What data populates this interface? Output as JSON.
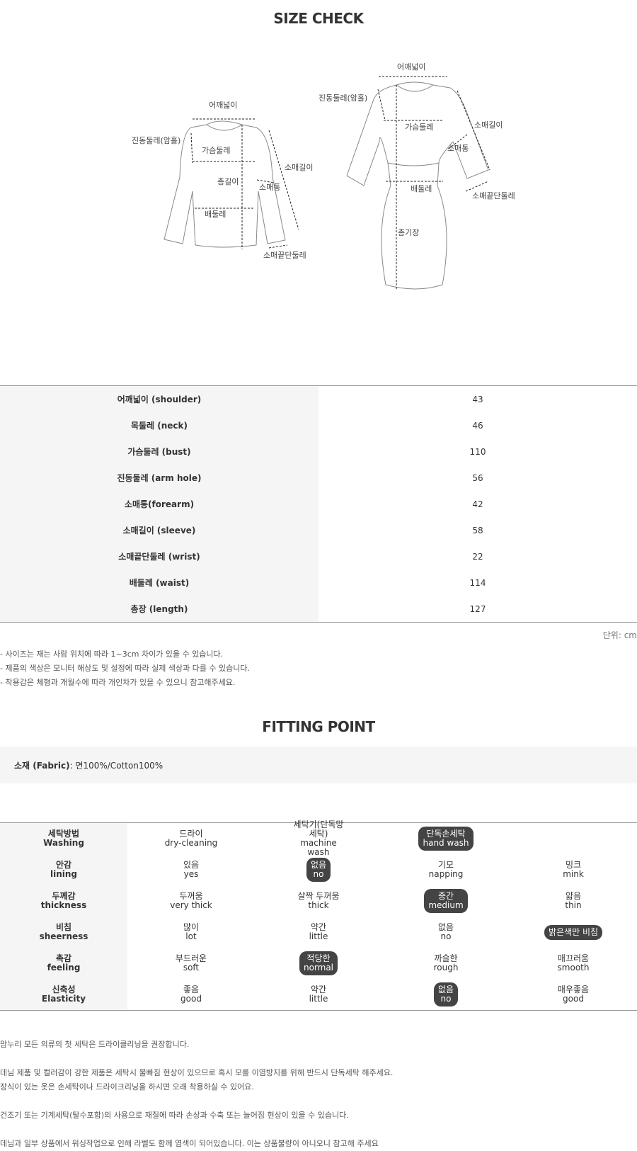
{
  "size_check": {
    "title": "SIZE CHECK",
    "diagram": {
      "top_labels": {
        "shoulder": "어깨넓이",
        "armhole": "진동둘레(암홀)",
        "bust": "가슴둘레",
        "length": "총길이",
        "forearm": "소매통",
        "sleeve": "소매길이",
        "waist": "배둘레",
        "wrist": "소매끝단둘레"
      },
      "dress_labels": {
        "shoulder": "어깨넓이",
        "armhole": "진동둘레(암홀)",
        "bust": "가슴둘레",
        "sleeve": "소매길이",
        "forearm": "소매통",
        "wrist": "소매끝단둘레",
        "waist": "배둘레",
        "length": "총기장"
      }
    },
    "rows": [
      {
        "label": "어깨넓이 (shoulder)",
        "value": "43"
      },
      {
        "label": "목둘레 (neck)",
        "value": "46"
      },
      {
        "label": "가슴둘레 (bust)",
        "value": "110"
      },
      {
        "label": "진동둘레 (arm hole)",
        "value": "56"
      },
      {
        "label": "소매통(forearm)",
        "value": "42"
      },
      {
        "label": "소매길이 (sleeve)",
        "value": "58"
      },
      {
        "label": "소매끝단둘레 (wrist)",
        "value": "22"
      },
      {
        "label": "배둘레 (waist)",
        "value": "114"
      },
      {
        "label": "총장 (length)",
        "value": "127"
      }
    ],
    "unit": "단위: cm",
    "notes": [
      "- 사이즈는 재는 사람 위치에 따라 1~3cm 차이가 있을 수 있습니다.",
      "- 제품의 색상은 모니터 해상도 및 설정에 따라 실제 색상과 다를 수 있습니다.",
      "- 착용감은 체형과 개월수에 따라 개인차가 있을 수 있으니 참고해주세요."
    ]
  },
  "fitting_point": {
    "title": "FITTING POINT",
    "fabric_label": "소재 (Fabric)",
    "fabric_value": " : 면100%/Cotton100%",
    "rows": [
      {
        "ko": "세탁방법",
        "en": "Washing",
        "options": [
          {
            "ko": "드라이",
            "en": "dry-cleaning",
            "selected": false
          },
          {
            "ko": "세탁기(단독망세탁)",
            "en": "machine wash",
            "selected": false
          },
          {
            "ko": "단독손세탁",
            "en": "hand wash",
            "selected": true
          },
          {
            "ko": "",
            "en": "",
            "selected": false
          }
        ]
      },
      {
        "ko": "안감",
        "en": "lining",
        "options": [
          {
            "ko": "있음",
            "en": "yes",
            "selected": false
          },
          {
            "ko": "없음",
            "en": "no",
            "selected": true
          },
          {
            "ko": "기모",
            "en": "napping",
            "selected": false
          },
          {
            "ko": "밍크",
            "en": "mink",
            "selected": false
          }
        ]
      },
      {
        "ko": "두께감",
        "en": "thickness",
        "options": [
          {
            "ko": "두꺼움",
            "en": "very thick",
            "selected": false
          },
          {
            "ko": "살짝 두꺼움",
            "en": "thick",
            "selected": false
          },
          {
            "ko": "중간",
            "en": "medium",
            "selected": true
          },
          {
            "ko": "얇음",
            "en": "thin",
            "selected": false
          }
        ]
      },
      {
        "ko": "비침",
        "en": "sheerness",
        "options": [
          {
            "ko": "많이",
            "en": "lot",
            "selected": false
          },
          {
            "ko": "약간",
            "en": "little",
            "selected": false
          },
          {
            "ko": "없음",
            "en": "no",
            "selected": false
          },
          {
            "ko": "밝은색만 비침",
            "en": "",
            "selected": true
          }
        ]
      },
      {
        "ko": "촉감",
        "en": "feeling",
        "options": [
          {
            "ko": "부드러운",
            "en": "soft",
            "selected": false
          },
          {
            "ko": "적당한",
            "en": "normal",
            "selected": true
          },
          {
            "ko": "까슬한",
            "en": "rough",
            "selected": false
          },
          {
            "ko": "매끄러움",
            "en": "smooth",
            "selected": false
          }
        ]
      },
      {
        "ko": "신축성",
        "en": "Elasticity",
        "options": [
          {
            "ko": "좋음",
            "en": "good",
            "selected": false
          },
          {
            "ko": "약간",
            "en": "little",
            "selected": false
          },
          {
            "ko": "없음",
            "en": "no",
            "selected": true
          },
          {
            "ko": "매우좋음",
            "en": "good",
            "selected": false
          }
        ]
      }
    ],
    "care_notes": [
      [
        "맘누리 모든 의류의 첫 세탁은 드라이클리닝을 권장합니다."
      ],
      [
        "데님 제품 및 컬러감이 강한 제품은 세탁시 물빠짐 현상이 있으므로 혹시 모를 이염방지를 위해 반드시 단독세탁 해주세요.",
        "장식이 있는 옷은 손세탁이나 드라이크리닝을 하시면 오래 착용하실 수 있어요."
      ],
      [
        "건조기 또는 기계세탁(탈수포함)의 사용으로 재질에 따라 손상과 수축 또는 늘어짐 현상이 있을 수 있습니다."
      ],
      [
        "데님과 일부 상품에서 워싱작업으로 인해 라벨도 함께 염색이 되어있습니다. 이는 상품불량이 아니오니 참고해 주세요"
      ]
    ]
  }
}
